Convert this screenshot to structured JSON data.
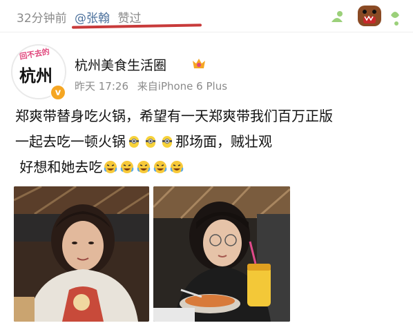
{
  "header": {
    "time": "32分钟前",
    "user": "@张翰",
    "action": "赞过"
  },
  "author": {
    "name": "杭州美食生活圈",
    "avatar_banner": "回不去的",
    "avatar_text": "杭州",
    "verified_mark": "v",
    "time": "昨天 17:26",
    "source": "来自iPhone 6 Plus"
  },
  "post": {
    "line1": "郑爽带替身吃火锅，希望有一天郑爽带我们百万正版",
    "line2_a": "一起去吃一顿火锅",
    "line2_b": "那场面，贼壮观",
    "line3": "好想和她去吃"
  },
  "icons": {
    "emoji_line2": "minion-emoji",
    "emoji_line3": "laughing-cry-emoji",
    "vip": "vip-crown-icon"
  },
  "colors": {
    "link": "#4a6f9b",
    "meta": "#8a8a8a",
    "mark": "#c83a3a",
    "badge": "#f5a623"
  }
}
